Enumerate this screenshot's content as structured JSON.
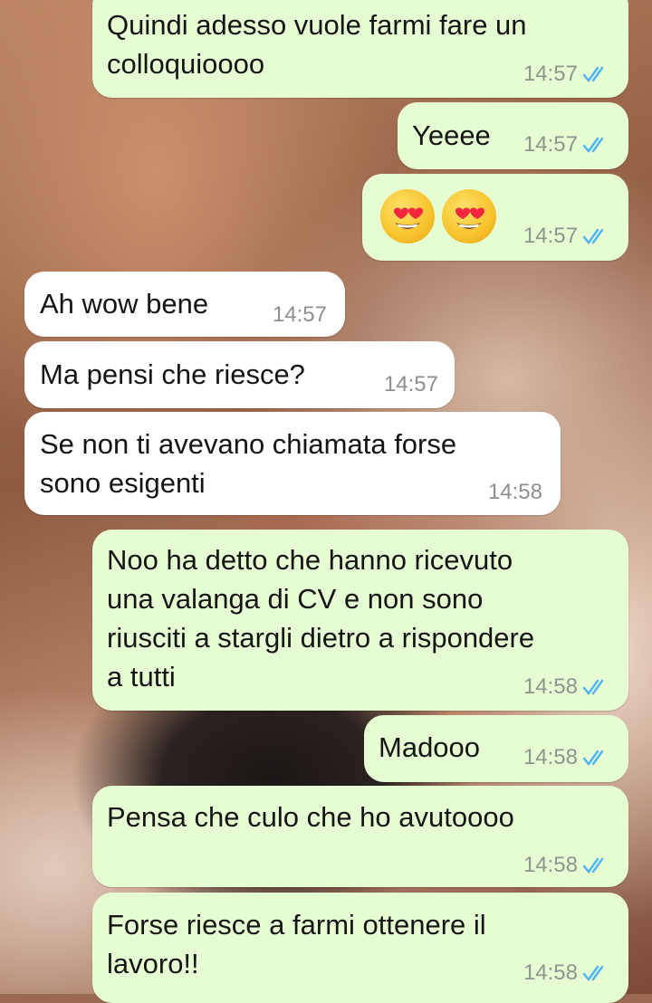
{
  "messages": [
    {
      "direction": "outgoing",
      "text": "Quindi adesso vuole farmi fare un\ncolloquioooo",
      "time": "14:57",
      "status": "read"
    },
    {
      "direction": "outgoing",
      "text": "Yeeee",
      "time": "14:57",
      "status": "read"
    },
    {
      "direction": "outgoing",
      "text": "😍😍",
      "emoji": "smiling-face-with-heart-eyes",
      "time": "14:57",
      "status": "read"
    },
    {
      "direction": "incoming",
      "text": "Ah wow bene",
      "time": "14:57"
    },
    {
      "direction": "incoming",
      "text": "Ma pensi che riesce?",
      "time": "14:57"
    },
    {
      "direction": "incoming",
      "text": "Se non ti avevano chiamata forse\nsono esigenti",
      "time": "14:58"
    },
    {
      "direction": "outgoing",
      "text": "Noo ha detto che hanno ricevuto\nuna valanga di CV e non sono\nriusciti a stargli dietro a rispondere\na tutti",
      "time": "14:58",
      "status": "read"
    },
    {
      "direction": "outgoing",
      "text": "Madooo",
      "time": "14:58",
      "status": "read"
    },
    {
      "direction": "outgoing",
      "text": "Pensa che culo che ho avutoooo",
      "time": "14:58",
      "status": "read"
    },
    {
      "direction": "outgoing",
      "text": "Forse riesce a farmi ottenere il\nlavoro!!",
      "time": "14:58",
      "status": "read"
    }
  ],
  "colors": {
    "outgoing_bubble": "#e6fdd3",
    "incoming_bubble": "#ffffff",
    "read_ticks": "#4fb3f6",
    "timestamp": "#8c968c"
  }
}
